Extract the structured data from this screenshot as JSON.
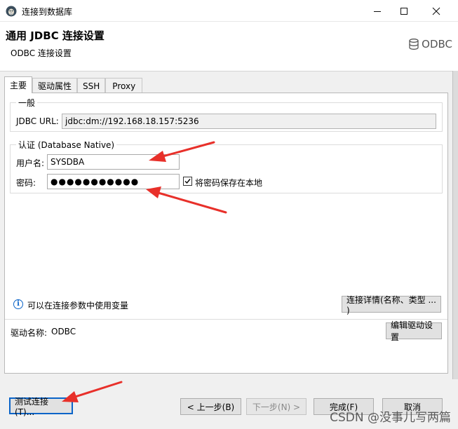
{
  "window": {
    "title": "连接到数据库",
    "controls": [
      "minimize",
      "maximize",
      "close"
    ]
  },
  "header": {
    "title": "通用 JDBC 连接设置",
    "subtitle": "ODBC 连接设置",
    "logo_text": "ODBC"
  },
  "tabs": [
    {
      "label": "主要",
      "active": true
    },
    {
      "label": "驱动属性",
      "active": false
    },
    {
      "label": "SSH",
      "active": false
    },
    {
      "label": "Proxy",
      "active": false
    }
  ],
  "general": {
    "legend": "一般",
    "jdbc_url_label": "JDBC URL:",
    "jdbc_url_value": "jdbc:dm://192.168.18.157:5236"
  },
  "auth": {
    "legend": "认证 (Database Native)",
    "username_label": "用户名:",
    "username_value": "SYSDBA",
    "password_label": "密码:",
    "password_masked": "●●●●●●●●●●●",
    "save_password_label": "将密码保存在本地",
    "save_password_checked": true
  },
  "info": {
    "text": "可以在连接参数中使用变量",
    "details_button": "连接详情(名称、类型 ... )"
  },
  "driver": {
    "label": "驱动名称:",
    "value": "ODBC",
    "edit_button": "编辑驱动设置"
  },
  "footer": {
    "test_button": "测试连接(T)...",
    "back_button": "< 上一步(B)",
    "next_button": "下一步(N) >",
    "finish_button": "完成(F)",
    "cancel_button": "取消"
  },
  "watermark": "CSDN @没事儿写两篇",
  "colors": {
    "arrow": "#e8302a",
    "accent": "#0a64c8"
  }
}
